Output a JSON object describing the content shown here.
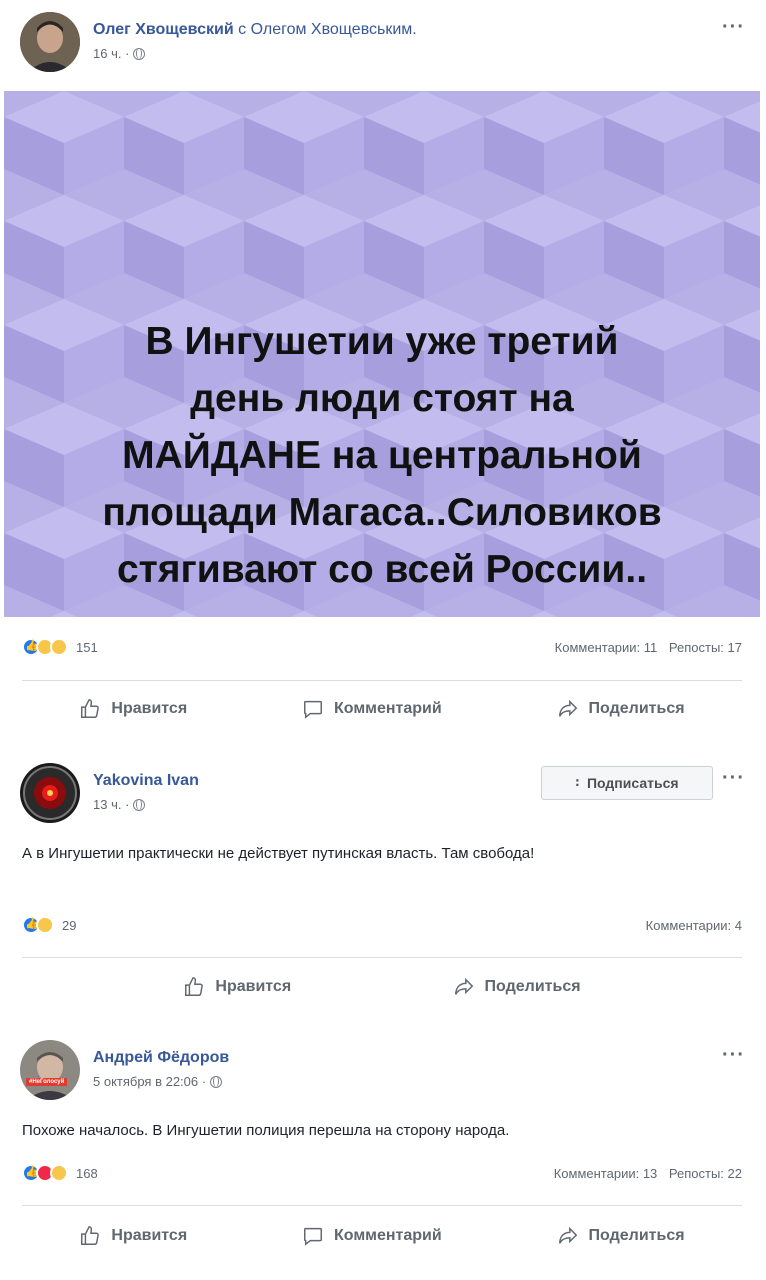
{
  "post1": {
    "author": "Олег Хвощевский",
    "with_text": "с Олегом Хвощевським.",
    "time": "16 ч. ·",
    "image_text_lines": [
      "В Ингушетии уже третий",
      "день люди стоят на",
      "МАЙДАНЕ на центральной",
      "площади Магаса..Силовиков",
      "стягивают со всей России.."
    ],
    "reaction_count": "151",
    "comments": "Комментарии: 11",
    "shares": "Репосты: 17"
  },
  "post2": {
    "author": "Yakovina Ivan",
    "time": "13 ч. ·",
    "follow_label": "Подписаться",
    "text": "А в Ингушетии практически не действует путинская власть. Там свобода!",
    "reaction_count": "29",
    "comments": "Комментарии: 4"
  },
  "post3": {
    "author": "Андрей Фёдоров",
    "avatar_tag": "#НеГолосуй",
    "time": "5 октября в 22:06 ·",
    "text": "Похоже началось. В Ингушетии полиция перешла на сторону народа.",
    "reaction_count": "168",
    "comments": "Комментарии: 13",
    "shares": "Репосты: 22"
  },
  "actions": {
    "like": "Нравится",
    "comment": "Комментарий",
    "share": "Поделиться"
  },
  "colors": {
    "link": "#385898",
    "hero_bg": "#b7b0e6",
    "like_blue": "#2078f4",
    "love_red": "#f0284a",
    "emoji_yellow": "#f7c64a"
  }
}
